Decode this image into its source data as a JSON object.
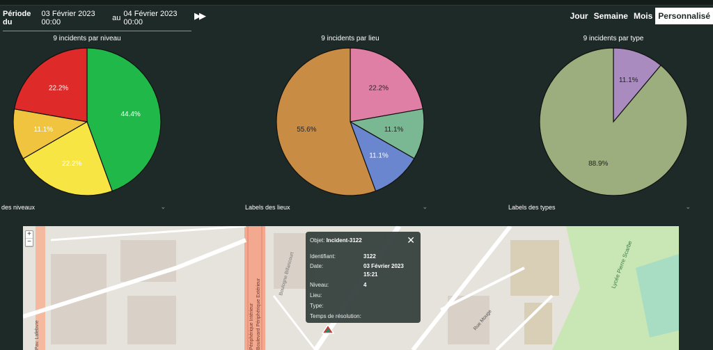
{
  "period": {
    "label": "Période du",
    "start": "03 Février 2023 00:00",
    "middle": "au",
    "end": "04 Février 2023 00:00"
  },
  "ranges": [
    {
      "label": "Jour",
      "active": false
    },
    {
      "label": "Semaine",
      "active": false
    },
    {
      "label": "Mois",
      "active": false
    },
    {
      "label": "Personnalisé",
      "active": true
    }
  ],
  "charts": [
    {
      "title": "9 incidents par niveau",
      "labels_title": "des niveaux"
    },
    {
      "title": "9 incidents par lieu",
      "labels_title": "Labels des lieux"
    },
    {
      "title": "9 incidents par type",
      "labels_title": "Labels des types"
    }
  ],
  "chart_data": [
    {
      "type": "pie",
      "title": "9 incidents par niveau",
      "slices": [
        {
          "value": 44.4,
          "label": "44.4%",
          "color": "#21b84a"
        },
        {
          "value": 22.2,
          "label": "22.2%",
          "color": "#f7e544"
        },
        {
          "value": 11.1,
          "label": "11.1%",
          "color": "#f0c43e"
        },
        {
          "value": 22.2,
          "label": "22.2%",
          "color": "#df2a2a"
        }
      ]
    },
    {
      "type": "pie",
      "title": "9 incidents par lieu",
      "slices": [
        {
          "value": 22.2,
          "label": "22.2%",
          "color": "#e07fa5"
        },
        {
          "value": 11.1,
          "label": "11.1%",
          "color": "#7ab894"
        },
        {
          "value": 11.1,
          "label": "11.1%",
          "color": "#6a86cf"
        },
        {
          "value": 55.6,
          "label": "55.6%",
          "color": "#c98c44"
        }
      ]
    },
    {
      "type": "pie",
      "title": "9 incidents par type",
      "slices": [
        {
          "value": 11.1,
          "label": "11.1%",
          "color": "#a98bbf"
        },
        {
          "value": 88.9,
          "label": "88.9%",
          "color": "#9cad7e"
        }
      ]
    }
  ],
  "popup": {
    "object_label": "Objet:",
    "object_value": "Incident-3122",
    "rows": [
      {
        "label": "Identifiant:",
        "value": "3122"
      },
      {
        "label": "Date:",
        "value": "03 Février 2023"
      },
      {
        "label": "",
        "value": "15:21"
      },
      {
        "label": "Niveau:",
        "value": "4"
      },
      {
        "label": "Lieu:",
        "value": ""
      },
      {
        "label": "Type:",
        "value": ""
      },
      {
        "label": "Temps de résolution:",
        "value": ""
      }
    ]
  },
  "map_labels": [
    "Boulevard Périphérique Extérieur",
    "Périphérique Intérieur",
    "Boulogne Billancourt",
    "Rue Mouge",
    "Lycée Pierre Scarbe",
    "Pav. Lafebvre"
  ]
}
